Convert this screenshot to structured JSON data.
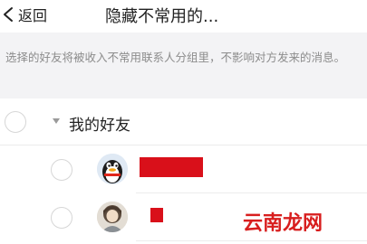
{
  "navbar": {
    "back_label": "返回",
    "title": "隐藏不常用的..."
  },
  "notice": {
    "text": "选择的好友将被收入不常用联系人分组里，不影响对方发来的消息。"
  },
  "group": {
    "label": "我的好友"
  },
  "watermark": {
    "text": "云南龙网"
  },
  "colors": {
    "redaction": "#d9101a",
    "watermark": "#d81e1e",
    "notice_background": "#f3f3f5"
  }
}
